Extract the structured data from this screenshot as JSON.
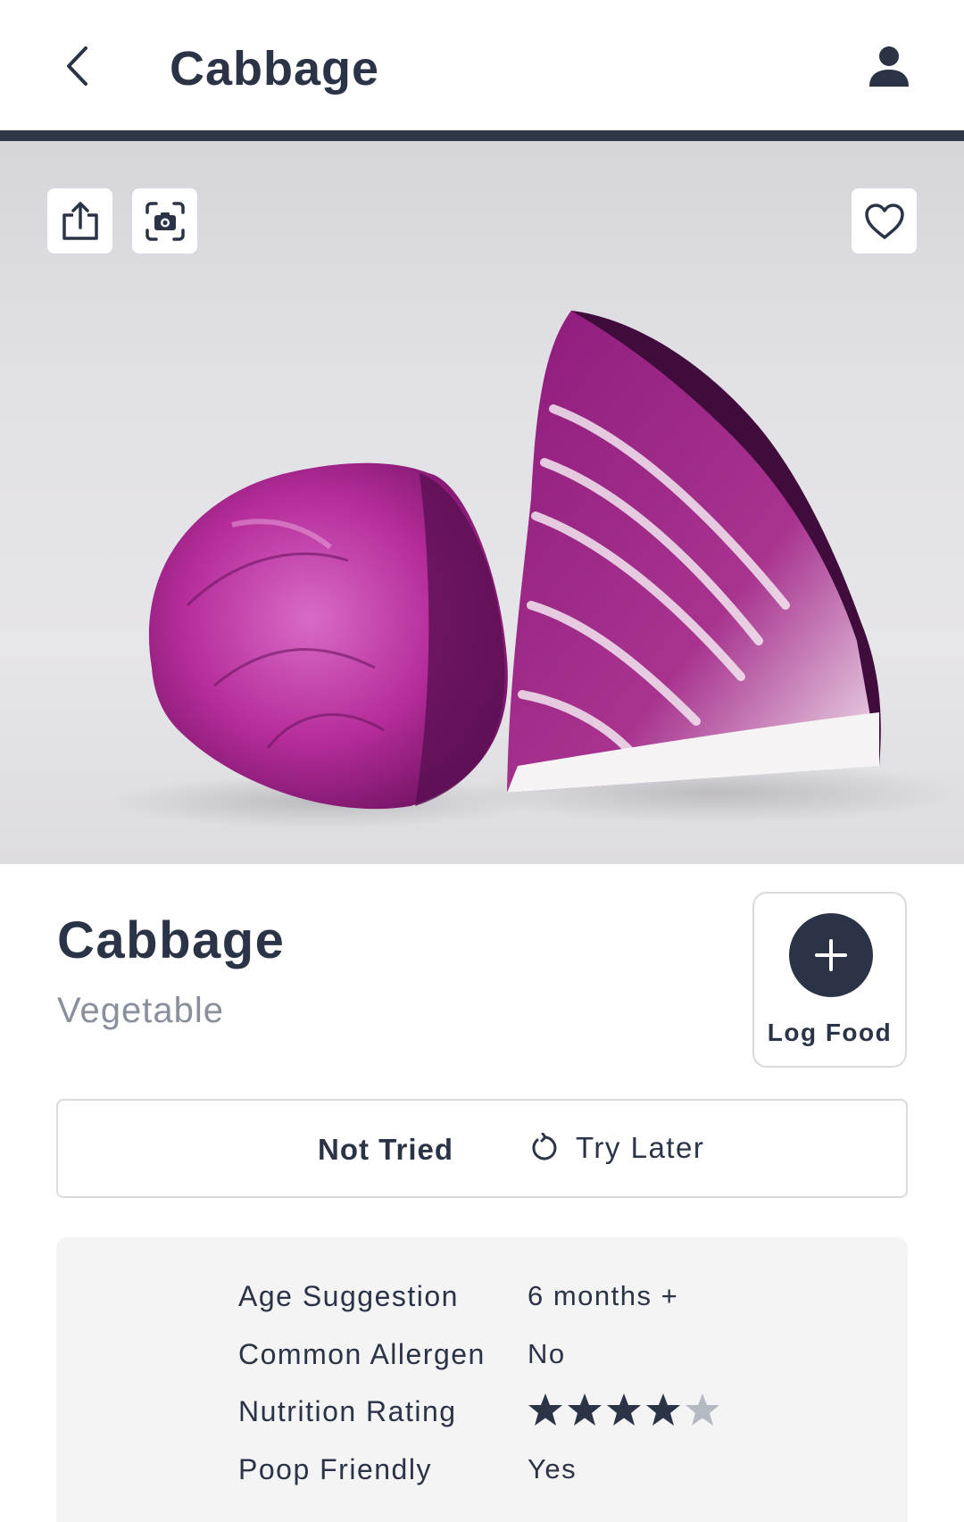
{
  "header": {
    "title": "Cabbage",
    "back_icon": "chevron-left-icon",
    "profile_icon": "user-icon"
  },
  "hero": {
    "image_subject": "red cabbage halves",
    "share_icon": "share-icon",
    "camera_icon": "camera-icon",
    "favorite_icon": "heart-icon"
  },
  "food": {
    "name": "Cabbage",
    "category": "Vegetable"
  },
  "log": {
    "label": "Log Food",
    "icon": "plus-icon"
  },
  "status": {
    "not_tried": "Not Tried",
    "try_later": "Try Later",
    "try_later_icon": "refresh-icon"
  },
  "details": {
    "age_label": "Age Suggestion",
    "age_value": "6 months +",
    "allergen_label": "Common Allergen",
    "allergen_value": "No",
    "nutrition_label": "Nutrition Rating",
    "nutrition_rating": 4,
    "nutrition_max": 5,
    "poop_label": "Poop Friendly",
    "poop_value": "Yes"
  },
  "colors": {
    "primary": "#2b3347",
    "muted": "#8a8f9c",
    "panel": "#f4f4f5",
    "star_off": "#b5b9c2"
  }
}
